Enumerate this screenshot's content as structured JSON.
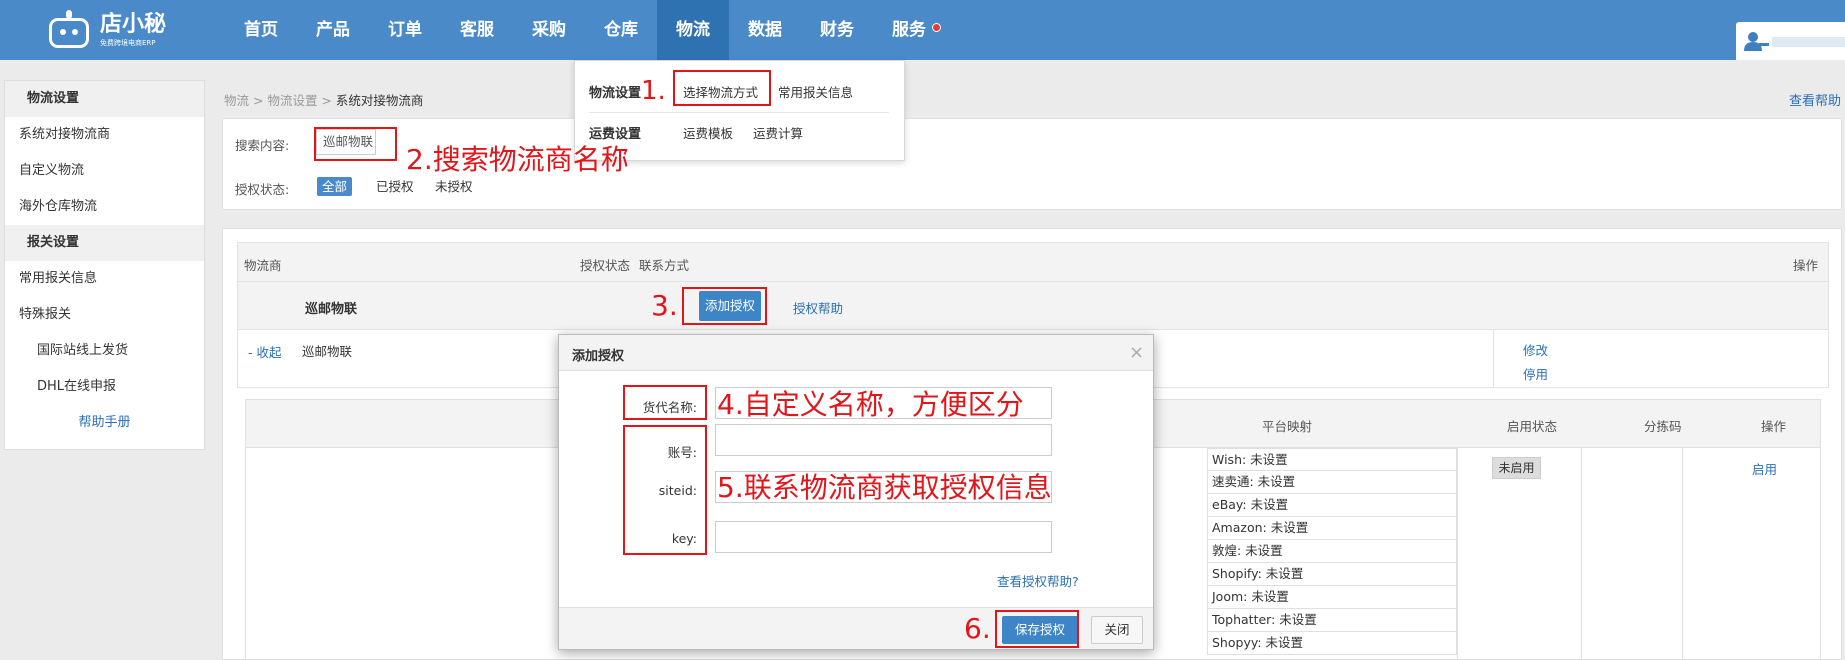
{
  "logo": {
    "title": "店小秘",
    "subtitle": "免费跨境电商ERP"
  },
  "nav": [
    {
      "label": "首页"
    },
    {
      "label": "产品"
    },
    {
      "label": "订单"
    },
    {
      "label": "客服"
    },
    {
      "label": "采购"
    },
    {
      "label": "仓库"
    },
    {
      "label": "物流",
      "active": true
    },
    {
      "label": "数据"
    },
    {
      "label": "财务"
    },
    {
      "label": "服务",
      "dot": true
    }
  ],
  "dropdown": {
    "cat1": "物流设置",
    "link_choose": "选择物流方式",
    "link_customs": "常用报关信息",
    "cat2": "运费设置",
    "link_template": "运费模板",
    "link_calc": "运费计算"
  },
  "sidebar": {
    "section1": "物流设置",
    "items1": [
      "系统对接物流商",
      "自定义物流",
      "海外仓库物流"
    ],
    "section2": "报关设置",
    "items2": [
      "常用报关信息",
      "特殊报关"
    ],
    "subitems2": [
      "国际站线上发货",
      "DHL在线申报"
    ],
    "help": "帮助手册"
  },
  "breadcrumb": {
    "p1": "物流",
    "sep": " > ",
    "p2": "物流设置",
    "cur": "系统对接物流商"
  },
  "help_link": "查看帮助",
  "search": {
    "label": "搜索内容:",
    "value": "巡邮物联",
    "auth_label": "授权状态:",
    "opt_all": "全部",
    "opt_authorized": "已授权",
    "opt_unauthorized": "未授权"
  },
  "list": {
    "col_provider": "物流商",
    "col_status": "授权状态",
    "col_contact": "联系方式",
    "col_action": "操作",
    "provider_name": "巡邮物联",
    "add_auth": "添加授权",
    "auth_help": "授权帮助",
    "collapse": "- 收起",
    "detail_name": "巡邮物联",
    "edit": "修改",
    "disable": "停用"
  },
  "subtable": {
    "col_platform": "平台映射",
    "col_enabled": "启用状态",
    "col_sort": "分拣码",
    "col_action": "操作",
    "platforms": [
      "Wish:  未设置",
      "速卖通:  未设置",
      "eBay:  未设置",
      "Amazon:  未设置",
      "敦煌:  未设置",
      "Shopify:  未设置",
      "Joom:  未设置",
      "Tophatter:  未设置",
      "Shopyy:  未设置"
    ],
    "status": "未启用",
    "enable": "启用"
  },
  "modal": {
    "title": "添加授权",
    "close_x": "×",
    "label_name": "货代名称:",
    "label_account": "账号:",
    "label_siteid": "siteid:",
    "label_key": "key:",
    "help": "查看授权帮助?",
    "save": "保存授权",
    "close": "关闭"
  },
  "annotations": {
    "a1": "1.",
    "a2": "2.搜索物流商名称",
    "a3": "3.",
    "a4": "4.自定义名称，方便区分",
    "a5": "5.联系物流商获取授权信息",
    "a6": "6."
  },
  "colors": {
    "topbar": "#4a8ac8",
    "nav_active": "#2f72b2",
    "primary_button": "#3d85c6",
    "link": "#2a6fb5",
    "annotation": "#e0161b"
  }
}
